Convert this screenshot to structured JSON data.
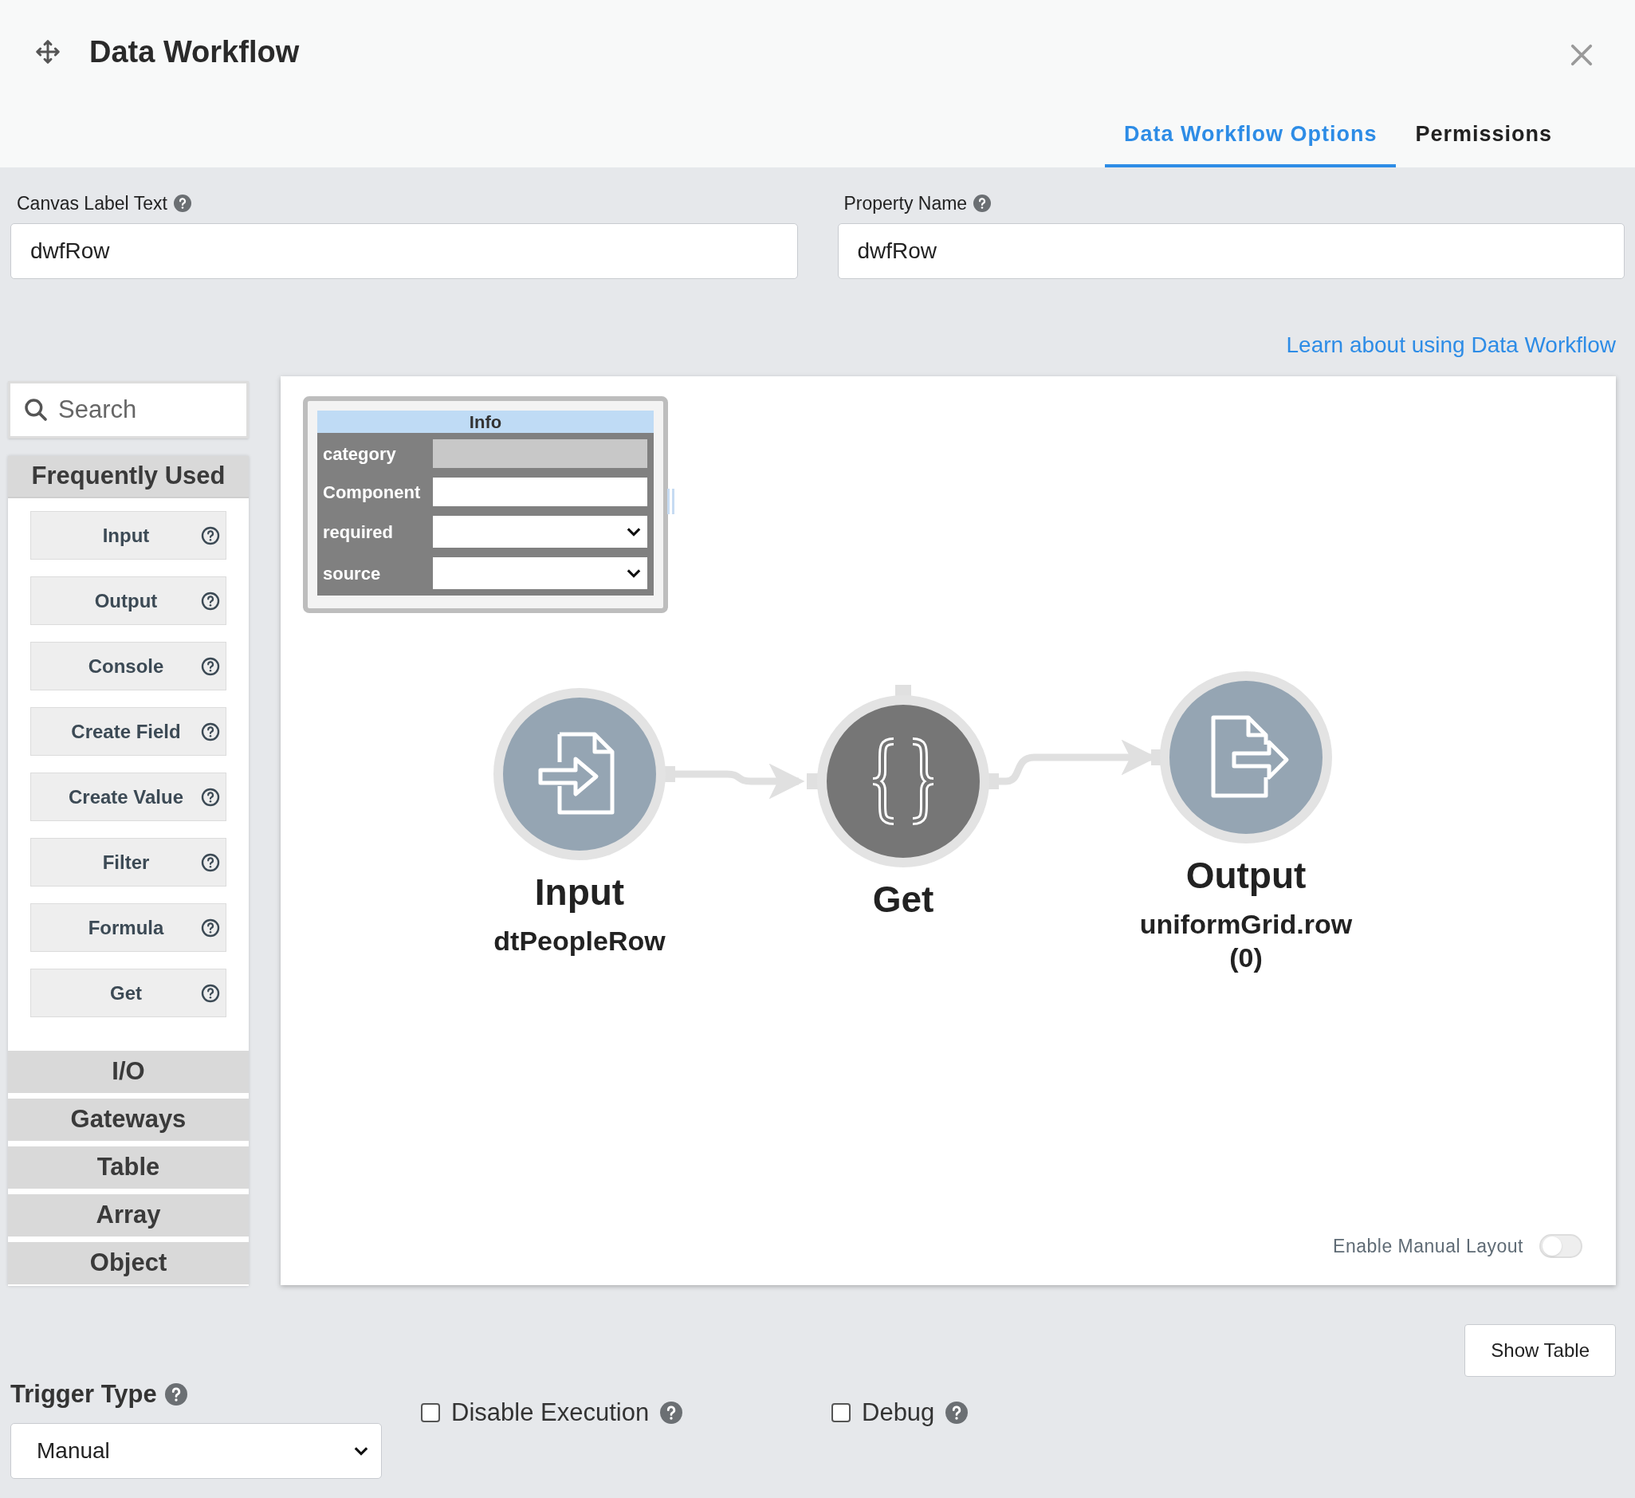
{
  "window": {
    "title": "Data Workflow"
  },
  "tabs": [
    {
      "label": "Data Workflow Options",
      "selected": true
    },
    {
      "label": "Permissions",
      "selected": false
    }
  ],
  "fields": [
    {
      "label": "Canvas Label Text",
      "value": "dwfRow"
    },
    {
      "label": "Property Name",
      "value": "dwfRow"
    }
  ],
  "help_link": "Learn about using Data Workflow",
  "palette": {
    "search": {
      "placeholder": "Search"
    },
    "sections": [
      {
        "title": "Frequently Used",
        "expanded": true,
        "items": [
          "Input",
          "Output",
          "Console",
          "Create Field",
          "Create Value",
          "Filter",
          "Formula",
          "Get"
        ]
      },
      {
        "title": "I/O",
        "expanded": false
      },
      {
        "title": "Gateways",
        "expanded": false
      },
      {
        "title": "Table",
        "expanded": false
      },
      {
        "title": "Array",
        "expanded": false
      },
      {
        "title": "Object",
        "expanded": false
      }
    ]
  },
  "canvas": {
    "info_panel": {
      "title": "Info",
      "rows": [
        {
          "label": "category",
          "kind": "readonly"
        },
        {
          "label": "Component",
          "kind": "text"
        },
        {
          "label": "required",
          "kind": "select"
        },
        {
          "label": "source",
          "kind": "select"
        }
      ]
    },
    "nodes": [
      {
        "kind": "input",
        "title": "Input",
        "subtitle": "dtPeopleRow"
      },
      {
        "kind": "get",
        "title": "Get"
      },
      {
        "kind": "output",
        "title": "Output",
        "subtitle": "uniformGrid.row (0)"
      }
    ],
    "manual_layout": {
      "label": "Enable Manual Layout",
      "on": false
    }
  },
  "show_table_button": "Show Table",
  "trigger_type": {
    "label": "Trigger Type",
    "value": "Manual"
  },
  "options": [
    {
      "label": "Disable Execution",
      "checked": false
    },
    {
      "label": "Debug",
      "checked": false
    }
  ]
}
